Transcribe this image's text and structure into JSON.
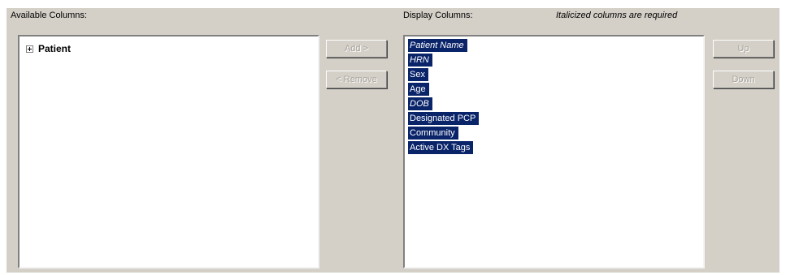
{
  "available": {
    "header": "Available Columns:",
    "tree": [
      {
        "label": "Patient",
        "expander": "plus-box-icon"
      }
    ]
  },
  "buttons": {
    "add": "Add >",
    "remove": "< Remove",
    "up": "Up",
    "down": "Down"
  },
  "display": {
    "header": "Display Columns:",
    "note": "Italicized columns are required",
    "items": [
      {
        "label": "Patient Name",
        "required": true,
        "selected": true
      },
      {
        "label": "HRN",
        "required": true,
        "selected": true
      },
      {
        "label": "Sex",
        "required": false,
        "selected": true
      },
      {
        "label": "Age",
        "required": false,
        "selected": true
      },
      {
        "label": "DOB",
        "required": true,
        "selected": true
      },
      {
        "label": "Designated PCP",
        "required": false,
        "selected": true
      },
      {
        "label": "Community",
        "required": false,
        "selected": true
      },
      {
        "label": "Active DX Tags",
        "required": false,
        "selected": true
      }
    ]
  },
  "colors": {
    "dialog_bg": "#d4d0c8",
    "selection_bg": "#0a246a",
    "selection_fg": "#ffffff",
    "disabled_text": "#a8a49c"
  }
}
